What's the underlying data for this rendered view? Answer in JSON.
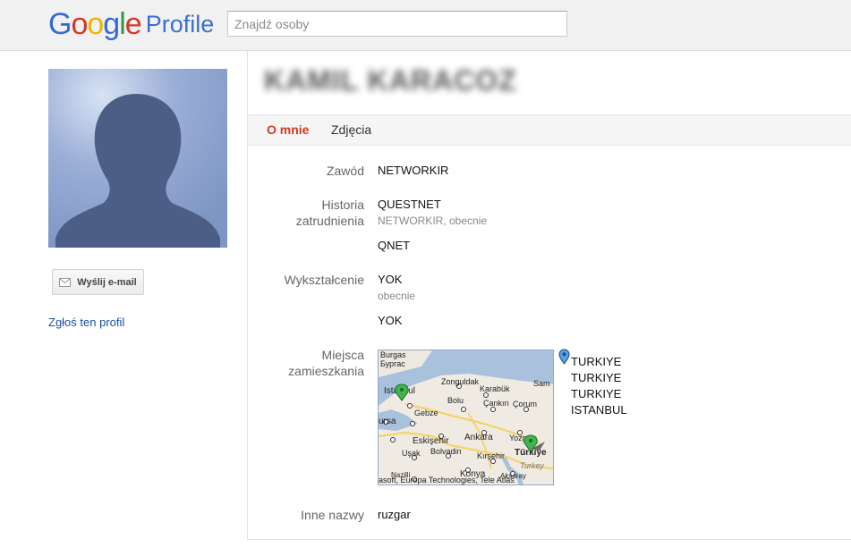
{
  "header": {
    "logo_google": [
      "G",
      "o",
      "o",
      "g",
      "l",
      "e"
    ],
    "logo_word": "Profile",
    "search_placeholder": "Znajdź osoby"
  },
  "profile": {
    "name": "KAMIL KARACOZ",
    "email_button": "Wyślij e-mail",
    "report_link": "Zgłoś ten profil"
  },
  "tabs": [
    {
      "label": "O mnie",
      "active": true
    },
    {
      "label": "Zdjęcia",
      "active": false
    }
  ],
  "about": {
    "occupation_label": "Zawód",
    "occupation": "NETWORKIR",
    "employment_label": [
      "Historia",
      "zatrudnienia"
    ],
    "employment": [
      {
        "name": "QUESTNET",
        "detail": "NETWORKIR, obecnie"
      },
      {
        "name": "QNET"
      }
    ],
    "education_label": "Wykształcenie",
    "education": [
      {
        "name": "YOK",
        "detail": "obecnie"
      },
      {
        "name": "YOK"
      }
    ],
    "places_label": [
      "Miejsca",
      "zamieszkania"
    ],
    "places": [
      "TURKIYE",
      "TURKIYE",
      "TURKIYE",
      "ISTANBUL"
    ],
    "map_labels": {
      "burgas": "Burgas",
      "burgas2": "Бургас",
      "zonguldak": "Zonguldak",
      "karabuk": "Karabük",
      "sam": "Sam",
      "istanbul": "Istanbul",
      "bolu": "Bolu",
      "cankiri": "Çankırı",
      "corum": "Çorum",
      "bursa": "ursa",
      "gebze": "Gebze",
      "eskisehir": "Eskişehir",
      "ankara": "Ankara",
      "yozgat": "Yozg",
      "usak": "Uşak",
      "bolvadin": "Bolvadin",
      "kirsehir": "Kırşehir",
      "turkiye": "Türkiye",
      "turkey": "Turkey",
      "konya": "Konya",
      "nazilli": "Nazilli",
      "aksaray": "Aksaray",
      "attribution": "asoft, Europa Technologies, Tele Atlas"
    },
    "other_names_label": "Inne nazwy",
    "other_names": "ruzgar"
  },
  "colors": {
    "active_tab": "#d63a1f",
    "link": "#1a4fa0",
    "avatar_bg": "#7f96c4",
    "avatar_silhouette": "#4c5d86"
  },
  "icons": [
    "envelope-icon",
    "map-pin-icon",
    "default-avatar-silhouette"
  ]
}
